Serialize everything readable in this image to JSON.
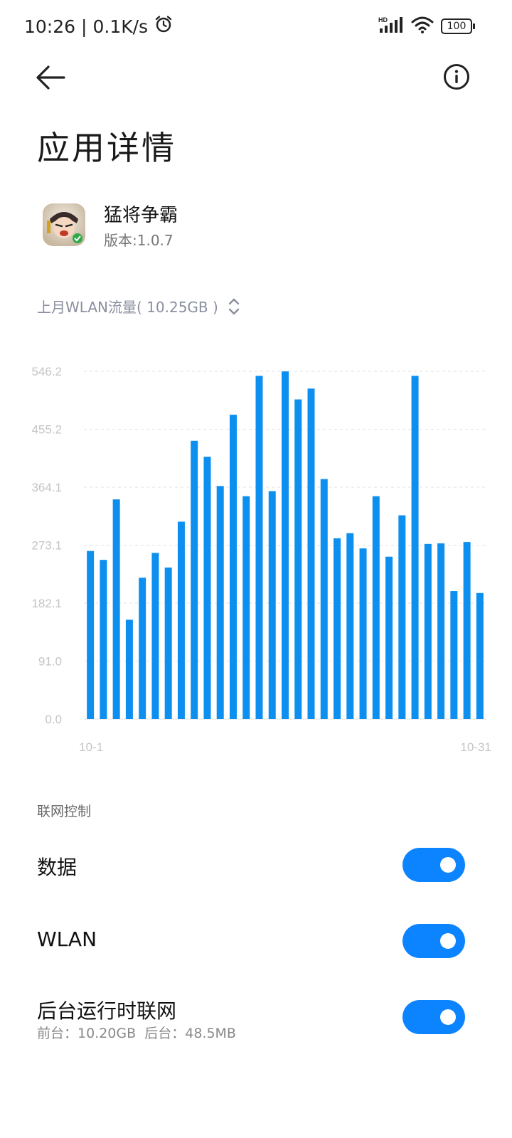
{
  "status_bar": {
    "time": "10:26",
    "speed": "0.1K/s",
    "battery": "100",
    "network_label": "HD"
  },
  "page": {
    "title": "应用详情"
  },
  "app": {
    "name": "猛将争霸",
    "version": "版本:1.0.7"
  },
  "usage": {
    "selector_label": "上月WLAN流量( 10.25GB )"
  },
  "chart_data": {
    "type": "bar",
    "title": "",
    "xlabel": "",
    "ylabel": "",
    "ylim": [
      0,
      546.2
    ],
    "yticks": [
      "0.0",
      "91.0",
      "182.1",
      "273.1",
      "364.1",
      "455.2",
      "546.2"
    ],
    "x_tick_labels": [
      "10-1",
      "10-31"
    ],
    "grid": true,
    "color": "#0d8ff0",
    "categories": [
      "10-1",
      "10-2",
      "10-3",
      "10-4",
      "10-5",
      "10-6",
      "10-7",
      "10-8",
      "10-9",
      "10-10",
      "10-11",
      "10-12",
      "10-13",
      "10-14",
      "10-15",
      "10-16",
      "10-17",
      "10-18",
      "10-19",
      "10-20",
      "10-21",
      "10-22",
      "10-23",
      "10-24",
      "10-25",
      "10-26",
      "10-27",
      "10-28",
      "10-29",
      "10-30",
      "10-31"
    ],
    "values": [
      264,
      250,
      345,
      156,
      222,
      261,
      238,
      310,
      437,
      412,
      366,
      478,
      350,
      539,
      358,
      546,
      502,
      519,
      377,
      284,
      292,
      268,
      350,
      255,
      320,
      539,
      275,
      276,
      201,
      278,
      198
    ]
  },
  "network_control": {
    "section_label": "联网控制",
    "items": [
      {
        "title": "数据",
        "enabled": true
      },
      {
        "title": "WLAN",
        "enabled": true
      },
      {
        "title": "后台运行时联网",
        "subtitle": "前台：10.20GB  后台：48.5MB",
        "enabled": true
      }
    ]
  },
  "colors": {
    "accent": "#0d84ff",
    "bar": "#0d8ff0"
  }
}
